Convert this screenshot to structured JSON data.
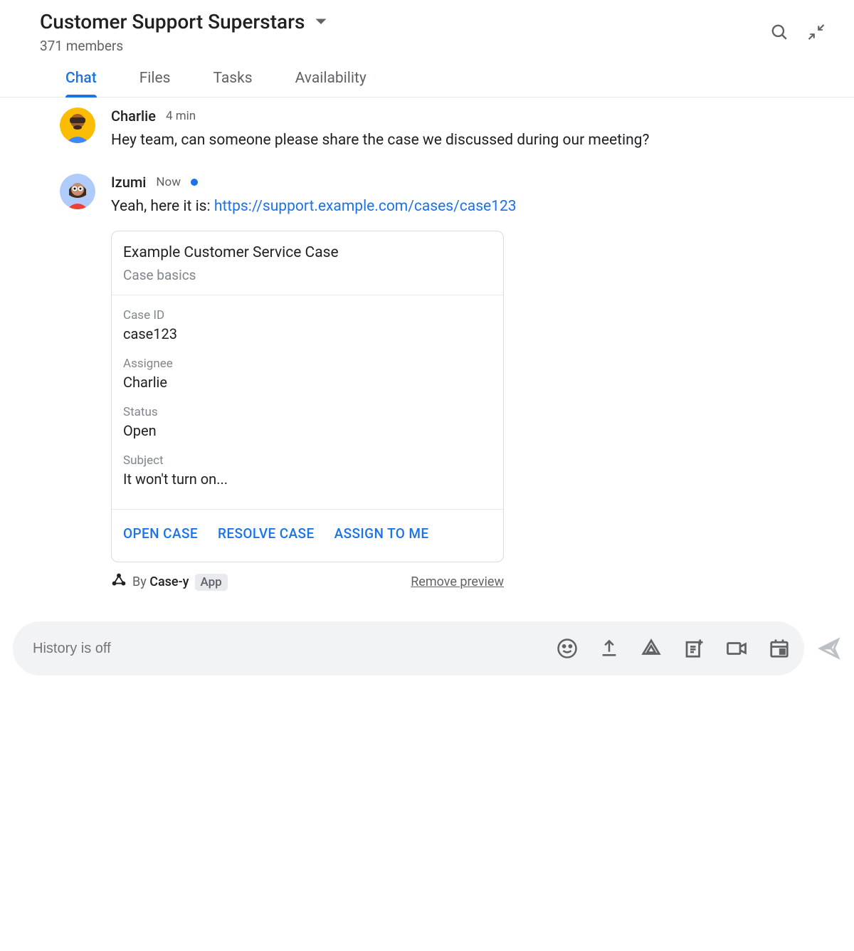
{
  "header": {
    "title": "Customer Support Superstars",
    "members": "371 members"
  },
  "tabs": [
    {
      "label": "Chat",
      "active": true
    },
    {
      "label": "Files",
      "active": false
    },
    {
      "label": "Tasks",
      "active": false
    },
    {
      "label": "Availability",
      "active": false
    }
  ],
  "messages": [
    {
      "author": "Charlie",
      "time": "4 min",
      "text": "Hey team, can someone please share the case we discussed during our meeting?"
    },
    {
      "author": "Izumi",
      "time": "Now",
      "status_dot": true,
      "text_prefix": "Yeah, here it is: ",
      "link": "https://support.example.com/cases/case123"
    }
  ],
  "card": {
    "title": "Example Customer Service Case",
    "subtitle": "Case basics",
    "fields": [
      {
        "label": "Case ID",
        "value": "case123"
      },
      {
        "label": "Assignee",
        "value": "Charlie"
      },
      {
        "label": "Status",
        "value": "Open"
      },
      {
        "label": "Subject",
        "value": "It won't turn on..."
      }
    ],
    "actions": [
      "OPEN CASE",
      "RESOLVE CASE",
      "ASSIGN TO ME"
    ]
  },
  "preview": {
    "by_prefix": "By ",
    "by_name": "Case-y",
    "badge": "App",
    "remove": "Remove preview"
  },
  "composer": {
    "placeholder": "History is off"
  }
}
